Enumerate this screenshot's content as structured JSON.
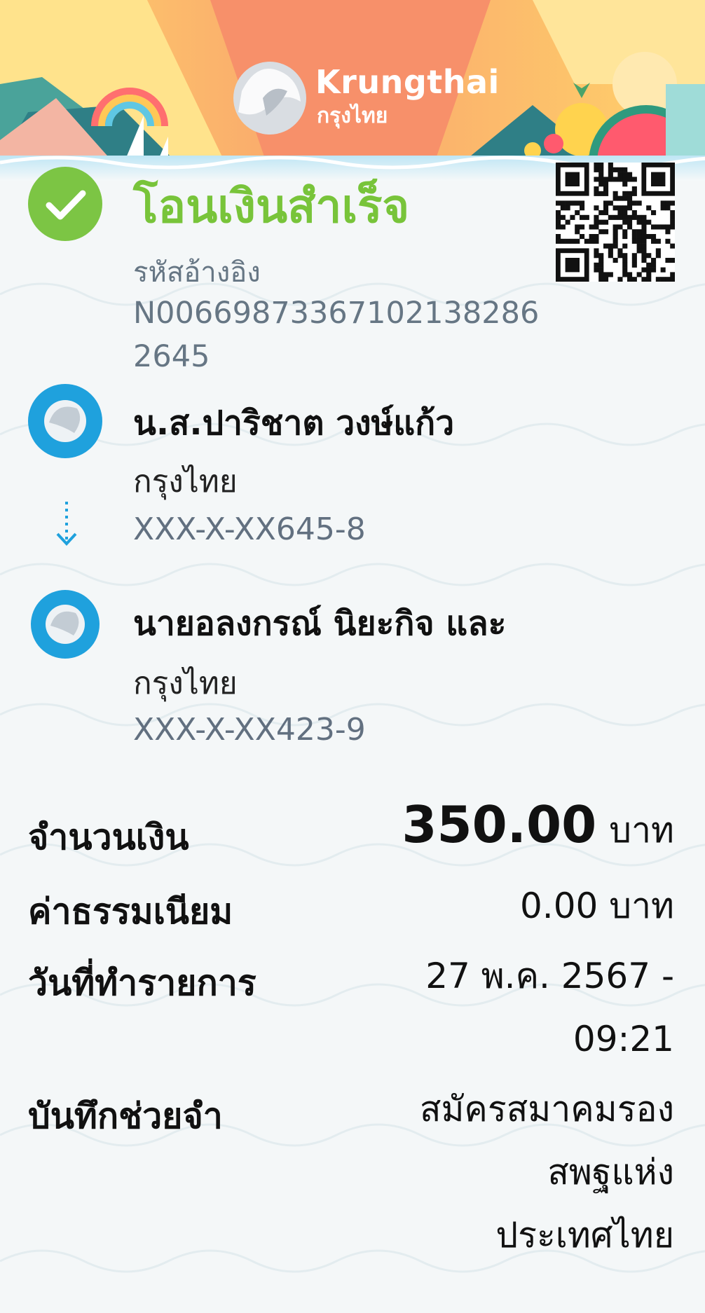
{
  "brand": {
    "name_en": "Krungthai",
    "name_th": "กรุงไทย"
  },
  "status": {
    "title": "โอนเงินสำเร็จ",
    "reference_label": "รหัสอ้างอิง",
    "reference_number": "N006698733671021382862645"
  },
  "sender": {
    "name": "น.ส.ปาริชาต วงษ์แก้ว",
    "bank": "กรุงไทย",
    "account": "XXX-X-XX645-8"
  },
  "receiver": {
    "name": "นายอลงกรณ์ นิยะกิจ และ",
    "bank": "กรุงไทย",
    "account": "XXX-X-XX423-9"
  },
  "details": {
    "amount_label": "จำนวนเงิน",
    "amount_value": "350.00",
    "amount_unit": "บาท",
    "fee_label": "ค่าธรรมเนียม",
    "fee_value": "0.00 บาท",
    "date_label": "วันที่ทำรายการ",
    "date_line1": "27 พ.ค. 2567 -",
    "date_line2": "09:21",
    "memo_label": "บันทึกช่วยจำ",
    "memo_line1": "สมัครสมาคมรอง",
    "memo_line2": "สพฐแห่ง",
    "memo_line3": "ประเทศไทย"
  },
  "icons": {
    "success": "check-circle-icon",
    "bank_logo": "krungthai-logo-icon",
    "arrow": "arrow-down-icon",
    "qr": "qr-code-icon"
  },
  "colors": {
    "success_green": "#78c43a",
    "bank_blue": "#1fa1dd",
    "header_orange": "#f7906a",
    "header_yellow": "#ffd36a"
  }
}
